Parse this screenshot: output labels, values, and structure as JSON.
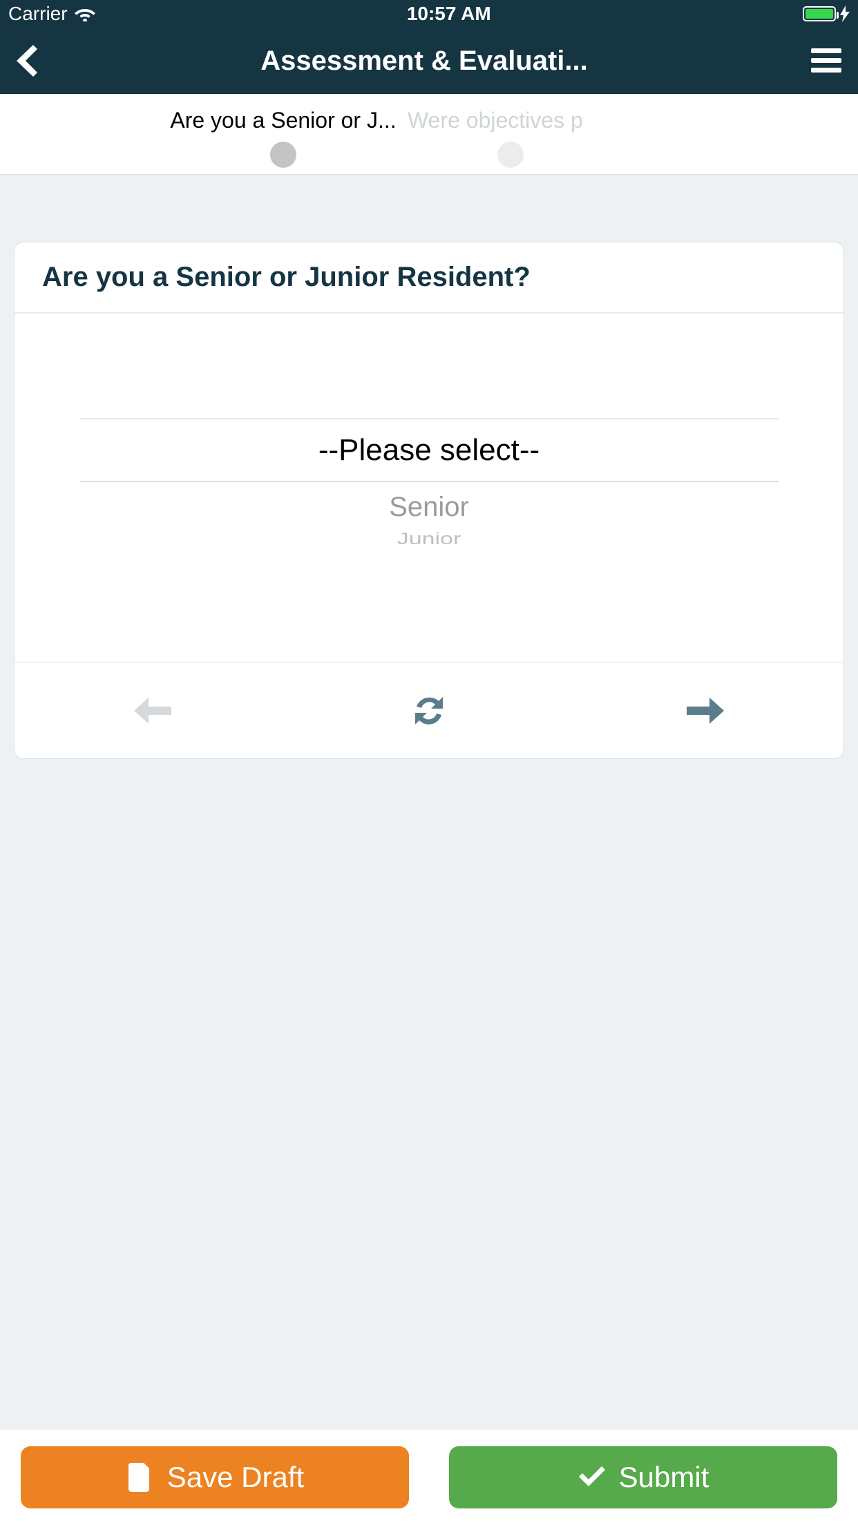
{
  "status": {
    "carrier": "Carrier",
    "time": "10:57 AM"
  },
  "nav": {
    "title": "Assessment & Evaluati..."
  },
  "steps": {
    "current": "Are you a Senior or J...",
    "next": "Were objectives p"
  },
  "question": {
    "title": "Are you a Senior or Junior Resident?",
    "picker_selected": "--Please select--",
    "options": [
      "Senior",
      "Junior"
    ]
  },
  "buttons": {
    "save": "Save Draft",
    "submit": "Submit"
  }
}
